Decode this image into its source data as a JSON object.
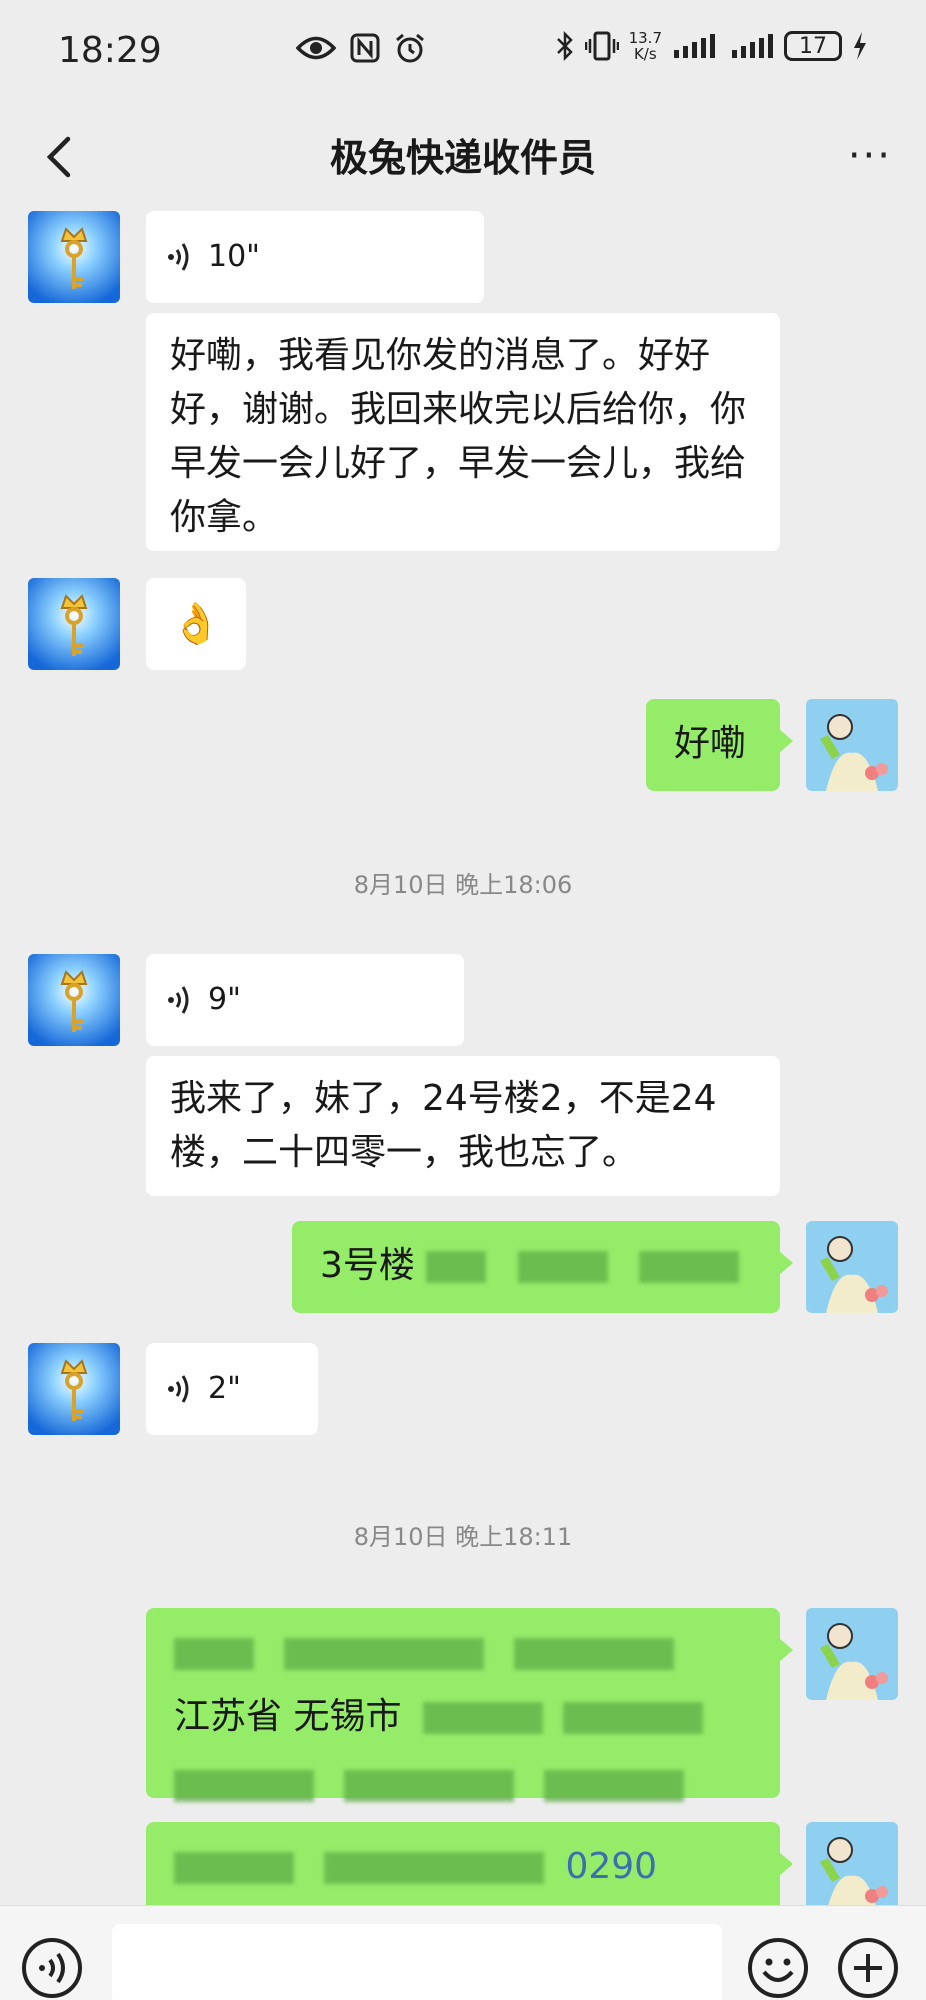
{
  "status_bar": {
    "time": "18:29",
    "net_speed_value": "13.7",
    "net_speed_unit": "K/s",
    "battery": "17"
  },
  "nav": {
    "title": "极兔快递收件员",
    "more_label": "···"
  },
  "messages": {
    "m1_voice": "10\"",
    "m2_text": "好嘞，我看见你发的消息了。好好好，谢谢。我回来收完以后给你，你早发一会儿好了，早发一会儿，我给你拿。",
    "m3_emoji": "👌",
    "m4_text": "好嘞",
    "ts1": "8月10日 晚上18:06",
    "m5_voice": "9\"",
    "m6_text": "我来了，妹了，24号楼2，不是24楼，二十四零一，我也忘了。",
    "m7_text": "3号楼",
    "m8_voice": "2\"",
    "ts2": "8月10日 晚上18:11",
    "m9_text": "江苏省 无锡市",
    "m10_text": "0290"
  },
  "input": {
    "placeholder": ""
  },
  "colors": {
    "chat_bg": "#ededed",
    "bubble_self": "#95ec69",
    "bubble_other": "#ffffff"
  }
}
